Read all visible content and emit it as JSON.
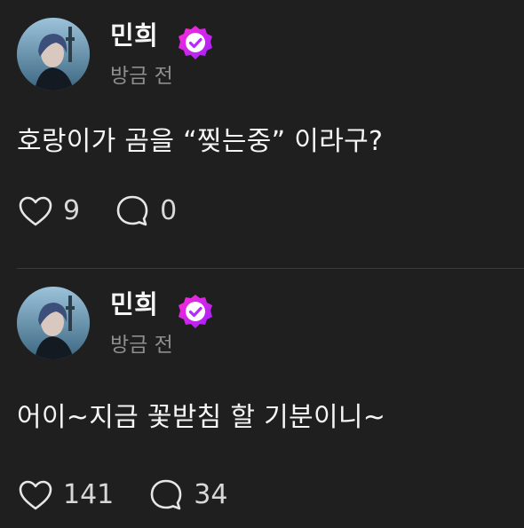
{
  "colors": {
    "background": "#1f1f1f",
    "text": "#f5f5f5",
    "muted": "#8e8e8e",
    "verified_gradient_start": "#ff2bd6",
    "verified_gradient_end": "#a020ff"
  },
  "posts": [
    {
      "author": "민희",
      "verified": true,
      "time": "방금 전",
      "text": "호랑이가 곰을 “찢는중” 이라구?",
      "likes": "9",
      "comments": "0",
      "icons": {
        "like": "heart-icon",
        "comment": "comment-bubble-icon",
        "badge": "verified-badge-icon"
      }
    },
    {
      "author": "민희",
      "verified": true,
      "time": "방금 전",
      "text": "어이~지금 꽃받침 할 기분이니~",
      "likes": "141",
      "comments": "34",
      "icons": {
        "like": "heart-icon",
        "comment": "comment-bubble-icon",
        "badge": "verified-badge-icon"
      }
    }
  ]
}
